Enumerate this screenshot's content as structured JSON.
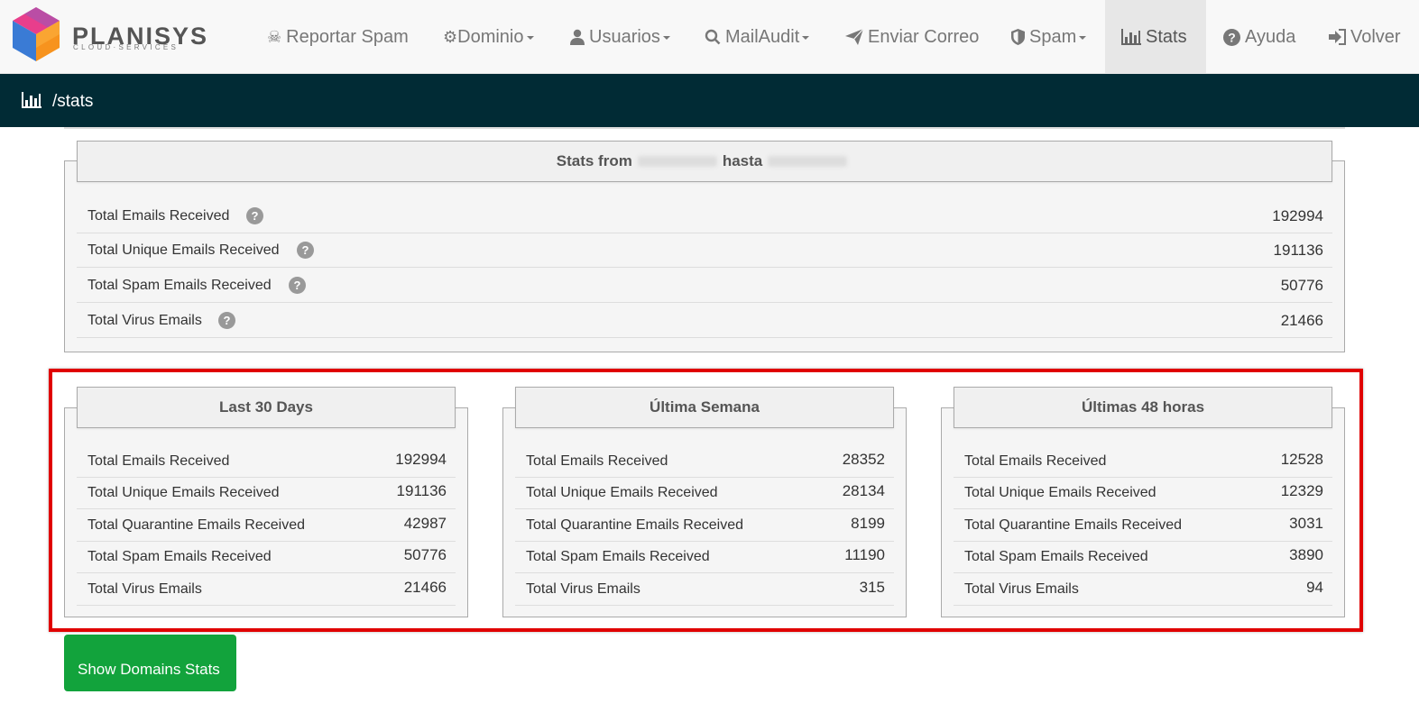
{
  "brand": {
    "name": "PLANISYS",
    "tagline": "CLOUD·SERVICES"
  },
  "nav": {
    "report_spam": "Reportar Spam",
    "dominio": "Dominio",
    "usuarios": "Usuarios",
    "mailaudit": "MailAudit",
    "enviar": "Enviar Correo",
    "spam": "Spam",
    "stats": "Stats",
    "ayuda": "Ayuda",
    "volver": "Volver"
  },
  "breadcrumb": "/stats",
  "summary": {
    "title_prefix": "Stats from",
    "title_middle": "hasta",
    "rows": [
      {
        "label": "Total Emails Received",
        "value": "192994"
      },
      {
        "label": "Total Unique Emails Received",
        "value": "191136"
      },
      {
        "label": "Total Spam Emails Received",
        "value": "50776"
      },
      {
        "label": "Total Virus Emails",
        "value": "21466"
      }
    ]
  },
  "periods": [
    {
      "title": "Last 30 Days",
      "rows": [
        {
          "label": "Total Emails Received",
          "value": "192994"
        },
        {
          "label": "Total Unique Emails Received",
          "value": "191136"
        },
        {
          "label": "Total Quarantine Emails Received",
          "value": "42987"
        },
        {
          "label": "Total Spam Emails Received",
          "value": "50776"
        },
        {
          "label": "Total Virus Emails",
          "value": "21466"
        }
      ]
    },
    {
      "title": "Última Semana",
      "rows": [
        {
          "label": "Total Emails Received",
          "value": "28352"
        },
        {
          "label": "Total Unique Emails Received",
          "value": "28134"
        },
        {
          "label": "Total Quarantine Emails Received",
          "value": "8199"
        },
        {
          "label": "Total Spam Emails Received",
          "value": "11190"
        },
        {
          "label": "Total Virus Emails",
          "value": "315"
        }
      ]
    },
    {
      "title": "Últimas 48 horas",
      "rows": [
        {
          "label": "Total Emails Received",
          "value": "12528"
        },
        {
          "label": "Total Unique Emails Received",
          "value": "12329"
        },
        {
          "label": "Total Quarantine Emails Received",
          "value": "3031"
        },
        {
          "label": "Total Spam Emails Received",
          "value": "3890"
        },
        {
          "label": "Total Virus Emails",
          "value": "94"
        }
      ]
    }
  ],
  "help_glyph": "?",
  "show_domains_button": "Show Domains Stats",
  "colors": {
    "nav_bg": "#f8f8f8",
    "crumb_bg": "#012b35",
    "highlight": "#e00000",
    "button": "#12a33c"
  }
}
